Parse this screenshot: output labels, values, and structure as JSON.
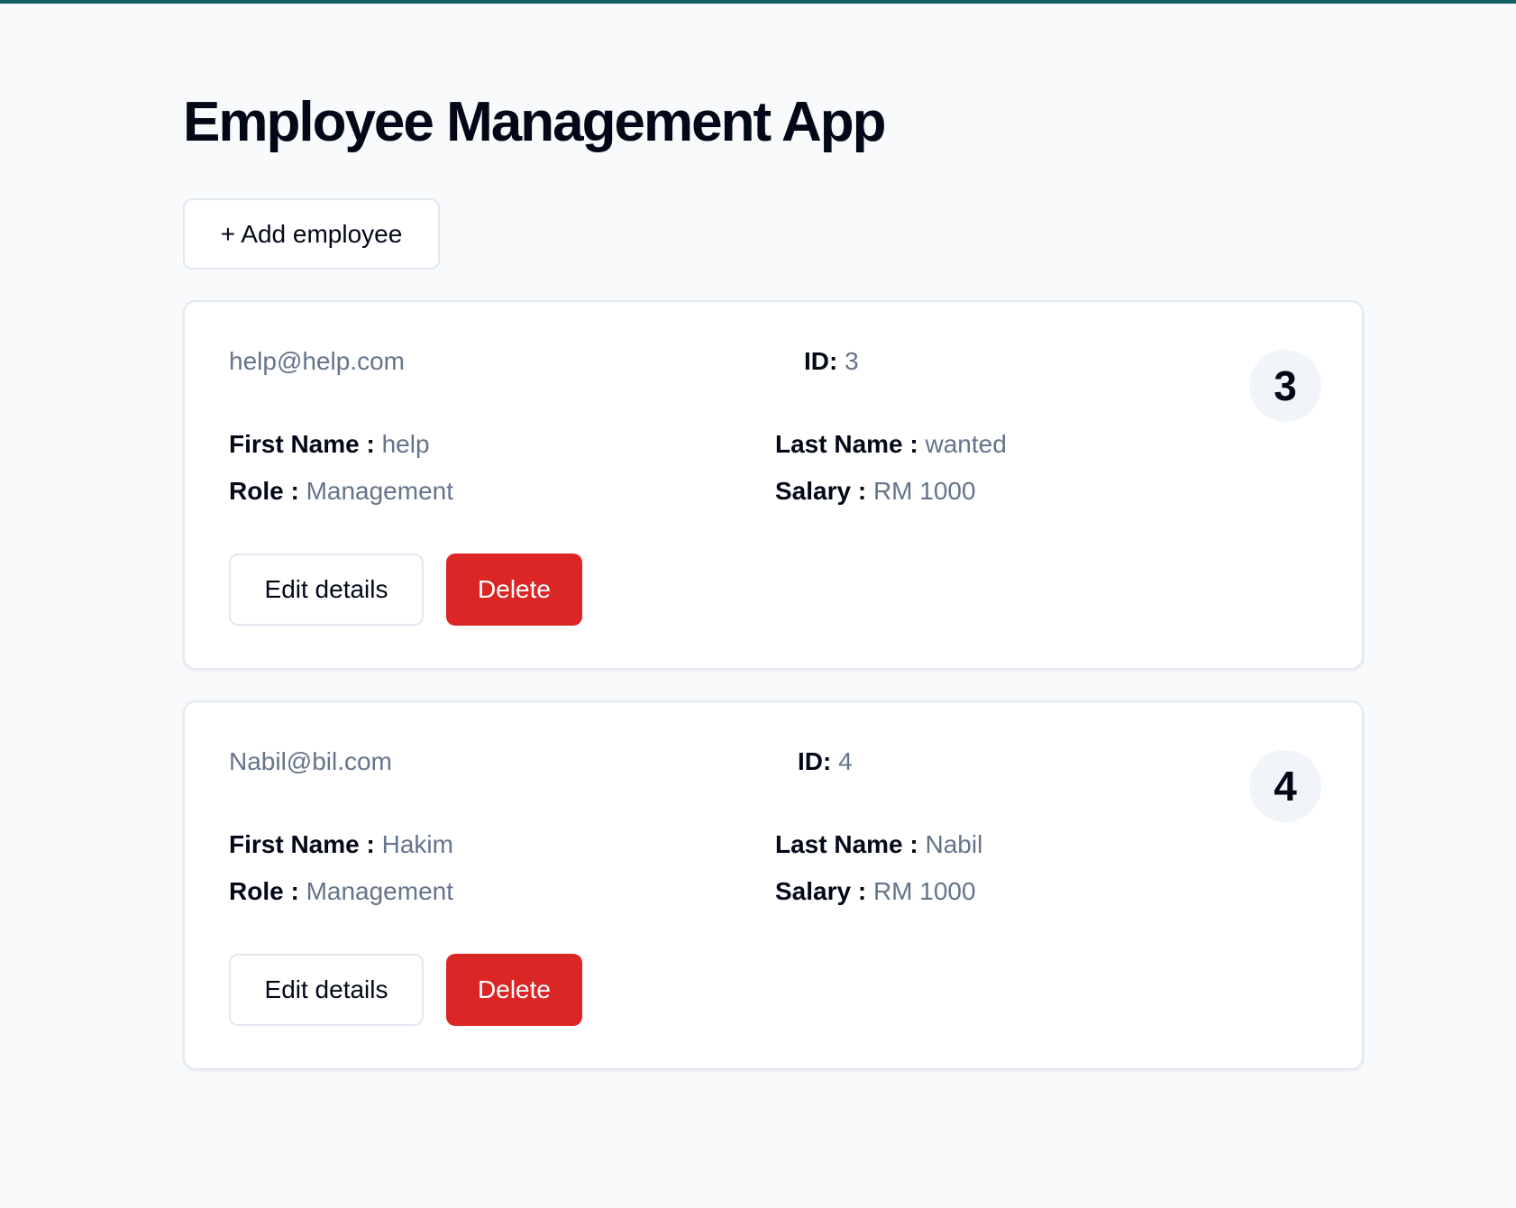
{
  "app": {
    "title": "Employee Management App",
    "accent_color": "#0f5f63"
  },
  "toolbar": {
    "add_label": "+ Add employee"
  },
  "labels": {
    "id": "ID:",
    "first_name": "First Name :",
    "last_name": "Last Name :",
    "role": "Role :",
    "salary": "Salary :",
    "edit": "Edit details",
    "delete": "Delete"
  },
  "colors": {
    "delete_button": "#dc2626",
    "muted_text": "#64748b",
    "avatar_bg": "#f1f5f9"
  },
  "employees": [
    {
      "email": "help@help.com",
      "id": "3",
      "avatar_text": "3",
      "first_name": "help",
      "last_name": "wanted",
      "role": "Management",
      "salary": "RM 1000"
    },
    {
      "email": "Nabil@bil.com",
      "id": "4",
      "avatar_text": "4",
      "first_name": "Hakim",
      "last_name": "Nabil",
      "role": "Management",
      "salary": "RM 1000"
    }
  ]
}
